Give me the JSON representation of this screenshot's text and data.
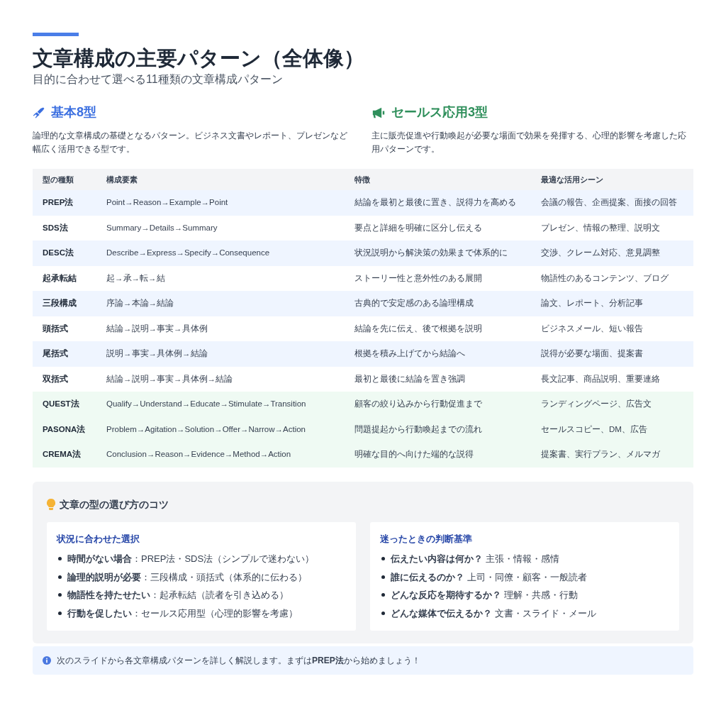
{
  "title": "文章構成の主要パターン（全体像）",
  "subtitle": "目的に合わせて選べる11種類の文章構成パターン",
  "sections": [
    {
      "kind": "basic",
      "heading": "基本8型",
      "description": "論理的な文章構成の基礎となるパターン。ビジネス文書やレポート、プレゼンなど幅広く活用できる型です。"
    },
    {
      "kind": "sales",
      "heading": "セールス応用3型",
      "description": "主に販売促進や行動喚起が必要な場面で効果を発揮する、心理的影響を考慮した応用パターンです。"
    }
  ],
  "table": {
    "columns": [
      "型の種類",
      "構成要素",
      "特徴",
      "最適な活用シーン"
    ],
    "rows": [
      {
        "kind": "basic",
        "cells": [
          "PREP法",
          "Point→Reason→Example→Point",
          "結論を最初と最後に置き、説得力を高める",
          "会議の報告、企画提案、面接の回答"
        ]
      },
      {
        "kind": "basic",
        "cells": [
          "SDS法",
          "Summary→Details→Summary",
          "要点と詳細を明確に区分し伝える",
          "プレゼン、情報の整理、説明文"
        ]
      },
      {
        "kind": "basic",
        "cells": [
          "DESC法",
          "Describe→Express→Specify→Consequence",
          "状況説明から解決策の効果まで体系的に",
          "交渉、クレーム対応、意見調整"
        ]
      },
      {
        "kind": "basic",
        "cells": [
          "起承転結",
          "起→承→転→結",
          "ストーリー性と意外性のある展開",
          "物語性のあるコンテンツ、ブログ"
        ]
      },
      {
        "kind": "basic",
        "cells": [
          "三段構成",
          "序論→本論→結論",
          "古典的で安定感のある論理構成",
          "論文、レポート、分析記事"
        ]
      },
      {
        "kind": "basic",
        "cells": [
          "頭括式",
          "結論→説明→事実→具体例",
          "結論を先に伝え、後で根拠を説明",
          "ビジネスメール、短い報告"
        ]
      },
      {
        "kind": "basic",
        "cells": [
          "尾括式",
          "説明→事実→具体例→結論",
          "根拠を積み上げてから結論へ",
          "説得が必要な場面、提案書"
        ]
      },
      {
        "kind": "basic",
        "cells": [
          "双括式",
          "結論→説明→事実→具体例→結論",
          "最初と最後に結論を置き強調",
          "長文記事、商品説明、重要連絡"
        ]
      },
      {
        "kind": "sales",
        "cells": [
          "QUEST法",
          "Qualify→Understand→Educate→Stimulate→Transition",
          "顧客の絞り込みから行動促進まで",
          "ランディングページ、広告文"
        ]
      },
      {
        "kind": "sales",
        "cells": [
          "PASONA法",
          "Problem→Agitation→Solution→Offer→Narrow→Action",
          "問題提起から行動喚起までの流れ",
          "セールスコピー、DM、広告"
        ]
      },
      {
        "kind": "sales",
        "cells": [
          "CREMA法",
          "Conclusion→Reason→Evidence→Method→Action",
          "明確な目的へ向けた端的な説得",
          "提案書、実行プラン、メルマガ"
        ]
      }
    ]
  },
  "tips": {
    "heading": "文章の型の選び方のコツ",
    "cards": [
      {
        "heading": "状況に合わせた選択",
        "items": [
          "**時間がない場合**：PREP法・SDS法（シンプルで迷わない）",
          "**論理的説明が必要**：三段構成・頭括式（体系的に伝わる）",
          "**物語性を持たせたい**：起承転結（読者を引き込める）",
          "**行動を促したい**：セールス応用型（心理的影響を考慮）"
        ]
      },
      {
        "heading": "迷ったときの判断基準",
        "items": [
          "**伝えたい内容は何か？** 主張・情報・感情",
          "**誰に伝えるのか？** 上司・同僚・顧客・一般読者",
          "**どんな反応を期待するか？** 理解・共感・行動",
          "**どんな媒体で伝えるか？** 文書・スライド・メール"
        ]
      }
    ]
  },
  "note": "次のスライドから各文章構成パターンを詳しく解説します。まずは**PREP法**から始めましょう！"
}
